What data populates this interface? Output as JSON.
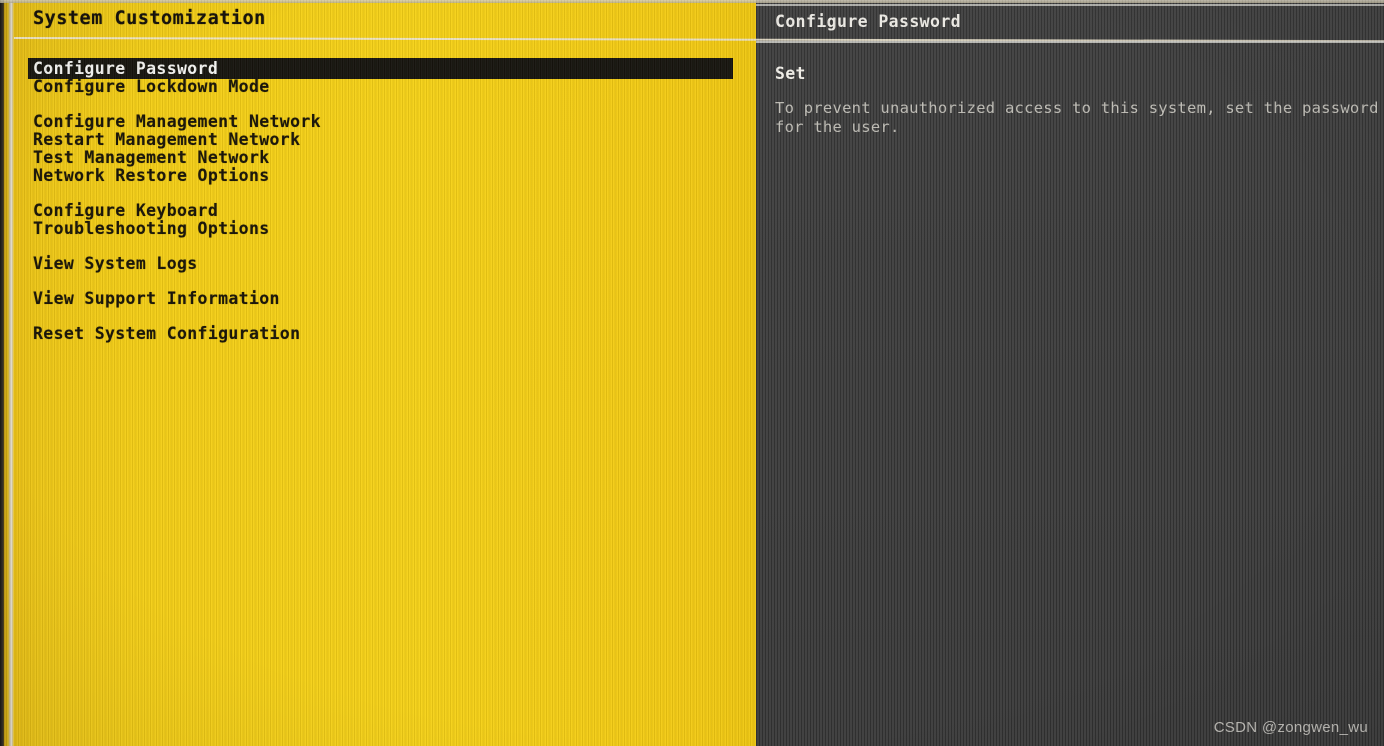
{
  "colors": {
    "panel_yellow": "#F3CD15",
    "panel_dark": "#3A3A3A",
    "selection_bg": "#100F0D",
    "selection_fg": "#F2F2EF",
    "rule_light": "#E8E0CB",
    "menu_text": "#1A1508",
    "body_text": "#BFBDB6"
  },
  "left_panel": {
    "title": "System Customization",
    "menu_groups": [
      {
        "items": [
          {
            "label": "Configure Password",
            "selected": true
          },
          {
            "label": "Configure Lockdown Mode",
            "selected": false
          }
        ]
      },
      {
        "items": [
          {
            "label": "Configure Management Network",
            "selected": false
          },
          {
            "label": "Restart Management Network",
            "selected": false
          },
          {
            "label": "Test Management Network",
            "selected": false
          },
          {
            "label": "Network Restore Options",
            "selected": false
          }
        ]
      },
      {
        "items": [
          {
            "label": "Configure Keyboard",
            "selected": false
          },
          {
            "label": "Troubleshooting Options",
            "selected": false
          }
        ]
      },
      {
        "items": [
          {
            "label": "View System Logs",
            "selected": false
          }
        ]
      },
      {
        "items": [
          {
            "label": "View Support Information",
            "selected": false
          }
        ]
      },
      {
        "items": [
          {
            "label": "Reset System Configuration",
            "selected": false
          }
        ]
      }
    ]
  },
  "right_panel": {
    "title": "Configure Password",
    "heading": "Set",
    "body": "To prevent unauthorized access to this system, set the password for the user."
  },
  "watermark": "CSDN @zongwen_wu"
}
